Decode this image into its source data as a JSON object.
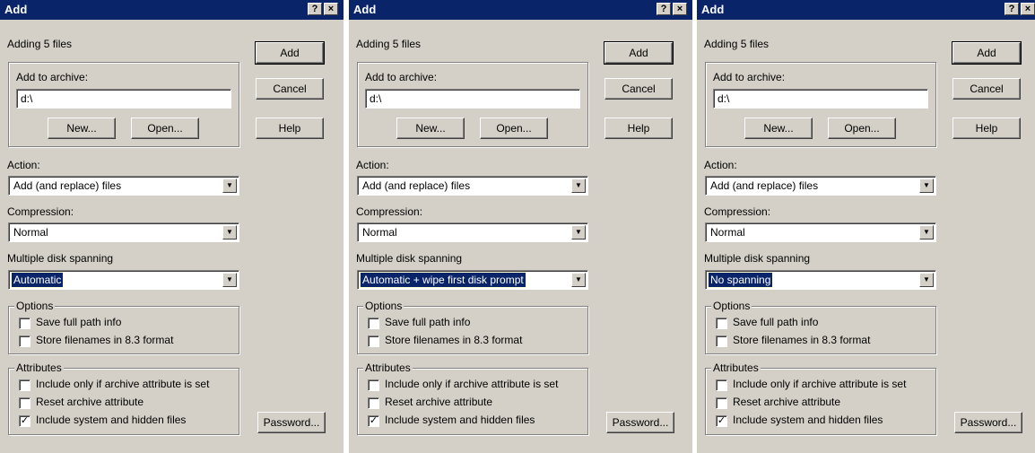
{
  "dialogs": [
    {
      "title": "Add",
      "help_btn": "?",
      "close_btn": "×",
      "adding_text": "Adding 5 files",
      "archive_group_label": "Add to archive:",
      "archive_value": "d:\\",
      "new_button": "New...",
      "open_button": "Open...",
      "add_button": "Add",
      "cancel_button": "Cancel",
      "help_button": "Help",
      "action_label": "Action:",
      "action_value": "Add (and replace) files",
      "compression_label": "Compression:",
      "compression_value": "Normal",
      "spanning_label": "Multiple disk spanning",
      "spanning_value": "Automatic",
      "options_group_label": "Options",
      "options": [
        "Save full path info",
        "Store filenames in 8.3 format"
      ],
      "attributes_group_label": "Attributes",
      "attributes": [
        "Include only if archive attribute is set",
        "Reset archive attribute",
        "Include system and hidden files"
      ],
      "attributes_checked": [
        false,
        false,
        true
      ],
      "password_button": "Password..."
    },
    {
      "title": "Add",
      "help_btn": "?",
      "close_btn": "×",
      "adding_text": "Adding 5 files",
      "archive_group_label": "Add to archive:",
      "archive_value": "d:\\",
      "new_button": "New...",
      "open_button": "Open...",
      "add_button": "Add",
      "cancel_button": "Cancel",
      "help_button": "Help",
      "action_label": "Action:",
      "action_value": "Add (and replace) files",
      "compression_label": "Compression:",
      "compression_value": "Normal",
      "spanning_label": "Multiple disk spanning",
      "spanning_value": "Automatic + wipe first disk prompt",
      "options_group_label": "Options",
      "options": [
        "Save full path info",
        "Store filenames in 8.3 format"
      ],
      "attributes_group_label": "Attributes",
      "attributes": [
        "Include only if archive attribute is set",
        "Reset archive attribute",
        "Include system and hidden files"
      ],
      "attributes_checked": [
        false,
        false,
        true
      ],
      "password_button": "Password..."
    },
    {
      "title": "Add",
      "help_btn": "?",
      "close_btn": "×",
      "adding_text": "Adding 5 files",
      "archive_group_label": "Add to archive:",
      "archive_value": "d:\\",
      "new_button": "New...",
      "open_button": "Open...",
      "add_button": "Add",
      "cancel_button": "Cancel",
      "help_button": "Help",
      "action_label": "Action:",
      "action_value": "Add (and replace) files",
      "compression_label": "Compression:",
      "compression_value": "Normal",
      "spanning_label": "Multiple disk spanning",
      "spanning_value": "No spanning",
      "options_group_label": "Options",
      "options": [
        "Save full path info",
        "Store filenames in 8.3 format"
      ],
      "attributes_group_label": "Attributes",
      "attributes": [
        "Include only if archive attribute is set",
        "Reset archive attribute",
        "Include system and hidden files"
      ],
      "attributes_checked": [
        false,
        false,
        true
      ],
      "password_button": "Password..."
    }
  ],
  "colors": {
    "titlebar": "#0a246a",
    "dialog_bg": "#d4d0c8",
    "selection": "#0a246a"
  }
}
